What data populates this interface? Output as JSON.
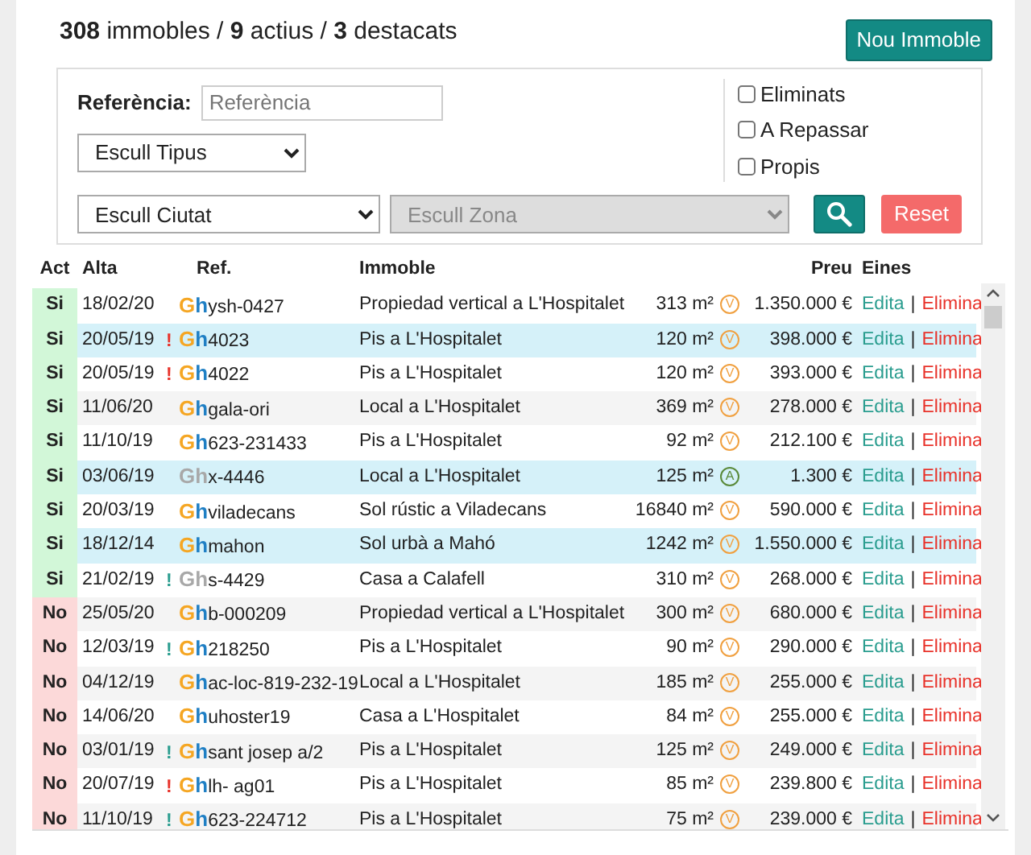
{
  "summary": {
    "text": "**308** immobles / **9** actius / **3** destacats"
  },
  "new_button": "Nou Immoble",
  "filters": {
    "reference_label": "Referència:",
    "reference_placeholder": "Referència",
    "type_select": "Escull Tipus",
    "city_select": "Escull Ciutat",
    "zone_select": {
      "value": "Escull Zona",
      "disabled": true
    },
    "checkboxes": [
      {
        "label": "Eliminats",
        "checked": false
      },
      {
        "label": "A Repassar",
        "checked": false
      },
      {
        "label": "Propis",
        "checked": false
      }
    ],
    "reset_button": "Reset"
  },
  "table": {
    "columns": [
      "Act",
      "Alta",
      "Ref.",
      "Immoble",
      "Preu",
      "Eines"
    ],
    "rows": [
      {
        "act": "Si",
        "active": true,
        "date": "18/02/20",
        "logo": "Gh",
        "logo_active": true,
        "ref": "ysh-0427",
        "property": "Propiedad vertical a L'Hospitalet",
        "area": "313 m²",
        "badge": {
          "text": "V",
          "color": "#f0a040"
        },
        "price": "1.350.000 €",
        "edit": "Edita",
        "separator": "|",
        "delete": "Elimina",
        "highlighted": false
      },
      {
        "act": "Si",
        "active": true,
        "date": "20/05/19",
        "alert": {
          "text": "!",
          "color": "#e8322a"
        },
        "logo": "Gh",
        "logo_active": true,
        "ref": "4023",
        "property": "Pis a L'Hospitalet",
        "area": "120 m²",
        "badge": {
          "text": "V",
          "color": "#f0a040"
        },
        "price": "398.000 €",
        "edit": "Edita",
        "separator": "|",
        "delete": "Elimina",
        "highlighted": true
      },
      {
        "act": "Si",
        "active": true,
        "date": "20/05/19",
        "alert": {
          "text": "!",
          "color": "#e8322a"
        },
        "logo": "Gh",
        "logo_active": true,
        "ref": "4022",
        "property": "Pis a L'Hospitalet",
        "area": "120 m²",
        "badge": {
          "text": "V",
          "color": "#f0a040"
        },
        "price": "393.000 €",
        "edit": "Edita",
        "separator": "|",
        "delete": "Elimina",
        "highlighted": false
      },
      {
        "act": "Si",
        "active": true,
        "date": "11/06/20",
        "logo": "Gh",
        "logo_active": true,
        "ref": "gala-ori",
        "property": "Local a L'Hospitalet",
        "area": "369 m²",
        "badge": {
          "text": "V",
          "color": "#f0a040"
        },
        "price": "278.000 €",
        "edit": "Edita",
        "separator": "|",
        "delete": "Elimina",
        "highlighted": false
      },
      {
        "act": "Si",
        "active": true,
        "date": "11/10/19",
        "logo": "Gh",
        "logo_active": true,
        "ref": "623-231433",
        "property": "Pis a L'Hospitalet",
        "area": "92 m²",
        "badge": {
          "text": "V",
          "color": "#f0a040"
        },
        "price": "212.100 €",
        "edit": "Edita",
        "separator": "|",
        "delete": "Elimina",
        "highlighted": false
      },
      {
        "act": "Si",
        "active": true,
        "date": "03/06/19",
        "logo": "Gh",
        "logo_active": false,
        "ref": "x-4446",
        "property": "Local a L'Hospitalet",
        "area": "125 m²",
        "badge": {
          "text": "A",
          "color": "#5a8a3a"
        },
        "price": "1.300 €",
        "edit": "Edita",
        "separator": "|",
        "delete": "Elimina",
        "highlighted": true
      },
      {
        "act": "Si",
        "active": true,
        "date": "20/03/19",
        "logo": "Gh",
        "logo_active": true,
        "ref": "viladecans",
        "property": "Sol rústic a Viladecans",
        "area": "16840 m²",
        "badge": {
          "text": "V",
          "color": "#f0a040"
        },
        "price": "590.000 €",
        "edit": "Edita",
        "separator": "|",
        "delete": "Elimina",
        "highlighted": false
      },
      {
        "act": "Si",
        "active": true,
        "date": "18/12/14",
        "logo": "Gh",
        "logo_active": true,
        "ref": "mahon",
        "property": "Sol urbà a Mahó",
        "area": "1242 m²",
        "badge": {
          "text": "V",
          "color": "#f0a040"
        },
        "price": "1.550.000 €",
        "edit": "Edita",
        "separator": "|",
        "delete": "Elimina",
        "highlighted": true
      },
      {
        "act": "Si",
        "active": true,
        "date": "21/02/19",
        "alert": {
          "text": "!",
          "color": "#2a9d8f"
        },
        "logo": "Gh",
        "logo_active": false,
        "ref": "s-4429",
        "property": "Casa a Calafell",
        "area": "310 m²",
        "badge": {
          "text": "V",
          "color": "#f0a040"
        },
        "price": "268.000 €",
        "edit": "Edita",
        "separator": "|",
        "delete": "Elimina",
        "highlighted": false
      },
      {
        "act": "No",
        "active": false,
        "date": "25/05/20",
        "logo": "Gh",
        "logo_active": true,
        "ref": "b-000209",
        "property": "Propiedad vertical a L'Hospitalet",
        "area": "300 m²",
        "badge": {
          "text": "V",
          "color": "#f0a040"
        },
        "price": "680.000 €",
        "edit": "Edita",
        "separator": "|",
        "delete": "Elimina",
        "highlighted": false
      },
      {
        "act": "No",
        "active": false,
        "date": "12/03/19",
        "alert": {
          "text": "!",
          "color": "#2a9d8f"
        },
        "logo": "Gh",
        "logo_active": true,
        "ref": "218250",
        "property": "Pis a L'Hospitalet",
        "area": "90 m²",
        "badge": {
          "text": "V",
          "color": "#f0a040"
        },
        "price": "290.000 €",
        "edit": "Edita",
        "separator": "|",
        "delete": "Elimina",
        "highlighted": false
      },
      {
        "act": "No",
        "active": false,
        "date": "04/12/19",
        "logo": "Gh",
        "logo_active": true,
        "ref": "ac-loc-819-232-19",
        "property": "Local a L'Hospitalet",
        "area": "185 m²",
        "badge": {
          "text": "V",
          "color": "#f0a040"
        },
        "price": "255.000 €",
        "edit": "Edita",
        "separator": "|",
        "delete": "Elimina",
        "highlighted": false
      },
      {
        "act": "No",
        "active": false,
        "date": "14/06/20",
        "logo": "Gh",
        "logo_active": true,
        "ref": "uhoster19",
        "property": "Casa a L'Hospitalet",
        "area": "84 m²",
        "badge": {
          "text": "V",
          "color": "#f0a040"
        },
        "price": "255.000 €",
        "edit": "Edita",
        "separator": "|",
        "delete": "Elimina",
        "highlighted": false
      },
      {
        "act": "No",
        "active": false,
        "date": "03/01/19",
        "alert": {
          "text": "!",
          "color": "#2a9d8f"
        },
        "logo": "Gh",
        "logo_active": true,
        "ref": "sant josep a/2",
        "property": "Pis a L'Hospitalet",
        "area": "125 m²",
        "badge": {
          "text": "V",
          "color": "#f0a040"
        },
        "price": "249.000 €",
        "edit": "Edita",
        "separator": "|",
        "delete": "Elimina",
        "highlighted": false
      },
      {
        "act": "No",
        "active": false,
        "date": "20/07/19",
        "alert": {
          "text": "!",
          "color": "#e8322a"
        },
        "logo": "Gh",
        "logo_active": true,
        "ref": "lh- ag01",
        "property": "Pis a L'Hospitalet",
        "area": "85 m²",
        "badge": {
          "text": "V",
          "color": "#f0a040"
        },
        "price": "239.800 €",
        "edit": "Edita",
        "separator": "|",
        "delete": "Elimina",
        "highlighted": false
      },
      {
        "act": "No",
        "active": false,
        "date": "11/10/19",
        "alert": {
          "text": "!",
          "color": "#2a9d8f"
        },
        "logo": "Gh",
        "logo_active": true,
        "ref": "623-224712",
        "property": "Pis a L'Hospitalet",
        "area": "75 m²",
        "badge": {
          "text": "V",
          "color": "#f0a040"
        },
        "price": "239.000 €",
        "edit": "Edita",
        "separator": "|",
        "delete": "Elimina",
        "highlighted": false
      }
    ]
  }
}
